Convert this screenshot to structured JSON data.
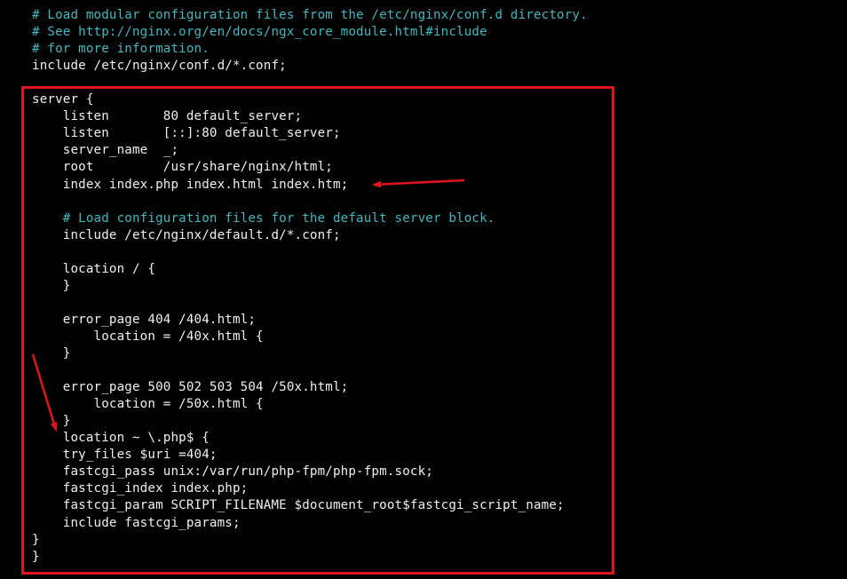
{
  "terminal": {
    "lines": [
      {
        "text": "# Load modular configuration files from the /etc/nginx/conf.d directory.",
        "type": "comment"
      },
      {
        "text": "# See http://nginx.org/en/docs/ngx_core_module.html#include",
        "type": "comment"
      },
      {
        "text": "# for more information.",
        "type": "comment"
      },
      {
        "text": "include /etc/nginx/conf.d/*.conf;",
        "type": "code"
      },
      {
        "text": "",
        "type": "code"
      },
      {
        "text": "server {",
        "type": "code"
      },
      {
        "text": "    listen       80 default_server;",
        "type": "code"
      },
      {
        "text": "    listen       [::]:80 default_server;",
        "type": "code"
      },
      {
        "text": "    server_name  _;",
        "type": "code"
      },
      {
        "text": "    root         /usr/share/nginx/html;",
        "type": "code"
      },
      {
        "text": "    index index.php index.html index.htm;",
        "type": "code"
      },
      {
        "text": "",
        "type": "code"
      },
      {
        "text": "    # Load configuration files for the default server block.",
        "type": "comment"
      },
      {
        "text": "    include /etc/nginx/default.d/*.conf;",
        "type": "code"
      },
      {
        "text": "",
        "type": "code"
      },
      {
        "text": "    location / {",
        "type": "code"
      },
      {
        "text": "    }",
        "type": "code"
      },
      {
        "text": "",
        "type": "code"
      },
      {
        "text": "    error_page 404 /404.html;",
        "type": "code"
      },
      {
        "text": "        location = /40x.html {",
        "type": "code"
      },
      {
        "text": "    }",
        "type": "code"
      },
      {
        "text": "",
        "type": "code"
      },
      {
        "text": "    error_page 500 502 503 504 /50x.html;",
        "type": "code"
      },
      {
        "text": "        location = /50x.html {",
        "type": "code"
      },
      {
        "text": "    }",
        "type": "code"
      },
      {
        "text": "    location ~ \\.php$ {",
        "type": "code"
      },
      {
        "text": "    try_files $uri =404;",
        "type": "code"
      },
      {
        "text": "    fastcgi_pass unix:/var/run/php-fpm/php-fpm.sock;",
        "type": "code"
      },
      {
        "text": "    fastcgi_index index.php;",
        "type": "code"
      },
      {
        "text": "    fastcgi_param SCRIPT_FILENAME $document_root$fastcgi_script_name;",
        "type": "code"
      },
      {
        "text": "    include fastcgi_params;",
        "type": "code"
      },
      {
        "text": "}",
        "type": "code"
      },
      {
        "text": "}",
        "type": "code"
      }
    ]
  },
  "annotations": {
    "highlight_color": "#e0141e",
    "comment_color": "#3fb8c0",
    "arrows": [
      {
        "name": "arrow-to-index-line",
        "points_to": "index index.php index.html index.htm;"
      },
      {
        "name": "arrow-to-php-location",
        "points_to": "location ~ \\.php$ {"
      }
    ]
  }
}
